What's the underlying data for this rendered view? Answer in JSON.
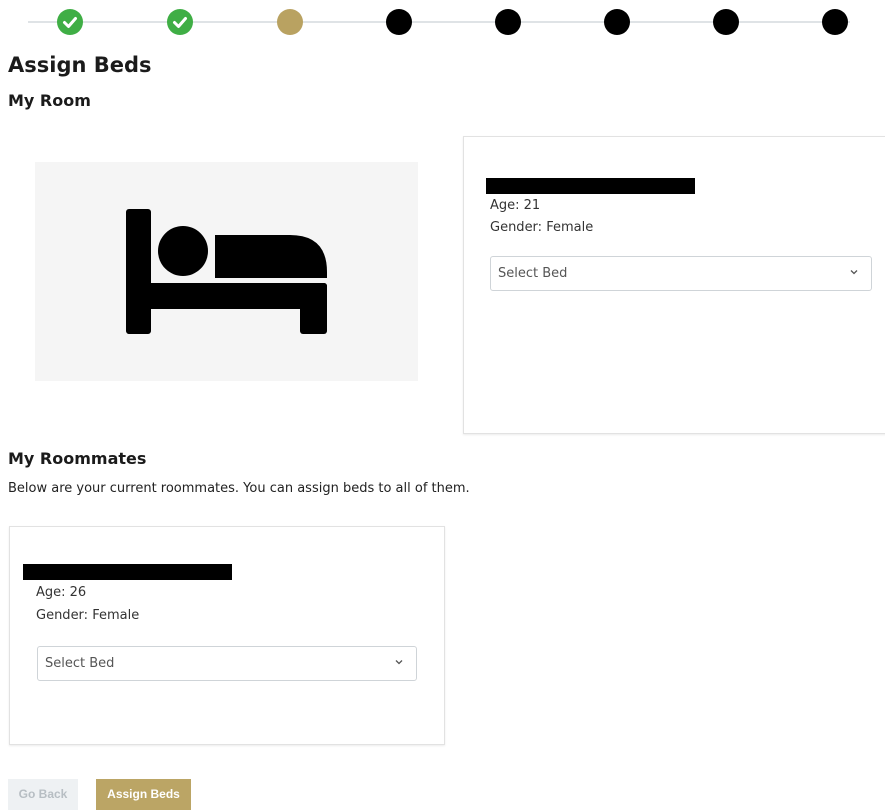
{
  "stepper": {
    "steps": [
      {
        "state": "done"
      },
      {
        "state": "done"
      },
      {
        "state": "current"
      },
      {
        "state": "pending"
      },
      {
        "state": "pending"
      },
      {
        "state": "pending"
      },
      {
        "state": "pending"
      },
      {
        "state": "pending"
      }
    ],
    "colors": {
      "done": "#3fae45",
      "current": "#b9a261",
      "pending": "#000000",
      "track": "#dfe3e6"
    }
  },
  "page": {
    "title": "Assign Beds",
    "my_room_heading": "My Room",
    "room_image_icon": "bed-icon"
  },
  "my_card": {
    "age": "Age: 21",
    "gender": "Gender: Female",
    "bed_select": {
      "value": "Select Bed",
      "icon": "chevron-down-icon"
    }
  },
  "roommates": {
    "heading": "My Roommates",
    "description": "Below are your current roommates. You can assign beds to all of them.",
    "items": [
      {
        "age": "Age: 26",
        "gender": "Gender: Female",
        "bed_select": {
          "value": "Select Bed",
          "icon": "chevron-down-icon"
        }
      }
    ]
  },
  "actions": {
    "back_label": "Go Back",
    "assign_label": "Assign Beds",
    "assign_color": "#bba565"
  }
}
